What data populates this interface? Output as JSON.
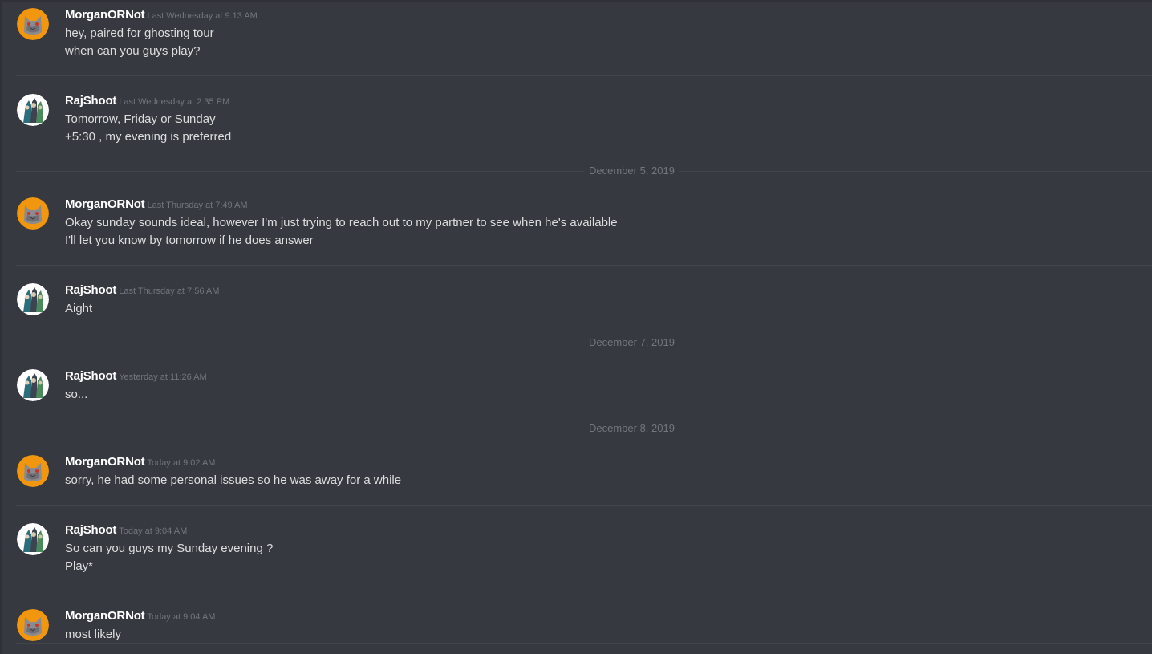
{
  "users": {
    "morgan": {
      "name": "MorganORNot",
      "avatar_icon": "gray-cat-avatar-icon",
      "avatar_bg": "#f0960f"
    },
    "raj": {
      "name": "RajShoot",
      "avatar_icon": "anime-character-avatar-icon",
      "avatar_bg": "#ffffff"
    }
  },
  "messages": [
    {
      "author": "MorganORNot",
      "timestamp": "Last Wednesday at 9:13 AM",
      "lines": [
        "hey, paired for ghosting tour",
        "when can you guys play?"
      ]
    },
    {
      "author": "RajShoot",
      "timestamp": "Last Wednesday at 2:35 PM",
      "lines": [
        "Tomorrow, Friday or Sunday",
        "+5:30 , my evening is preferred"
      ]
    },
    {
      "author": "MorganORNot",
      "timestamp": "Last Thursday at 7:49 AM",
      "lines": [
        "Okay sunday sounds ideal, however I'm just trying to reach out to my partner to see when he's available",
        "I'll let you know by tomorrow if he does answer"
      ]
    },
    {
      "author": "RajShoot",
      "timestamp": "Last Thursday at 7:56 AM",
      "lines": [
        "Aight"
      ]
    },
    {
      "author": "RajShoot",
      "timestamp": "Yesterday at 11:26 AM",
      "lines": [
        "so..."
      ]
    },
    {
      "author": "MorganORNot",
      "timestamp": "Today at 9:02 AM",
      "lines": [
        "sorry, he had some personal issues so he was away for a while"
      ]
    },
    {
      "author": "RajShoot",
      "timestamp": "Today at 9:04 AM",
      "lines": [
        "So can you guys my Sunday evening ?",
        "Play*"
      ]
    },
    {
      "author": "MorganORNot",
      "timestamp": "Today at 9:04 AM",
      "lines": [
        "most likely"
      ]
    }
  ],
  "date_dividers": [
    "December 5, 2019",
    "December 7, 2019",
    "December 8, 2019"
  ],
  "colors": {
    "background": "#36393f",
    "username": "#ffffff",
    "message_text": "#dcddde",
    "timestamp": "#72767d",
    "divider": "#42454a"
  }
}
